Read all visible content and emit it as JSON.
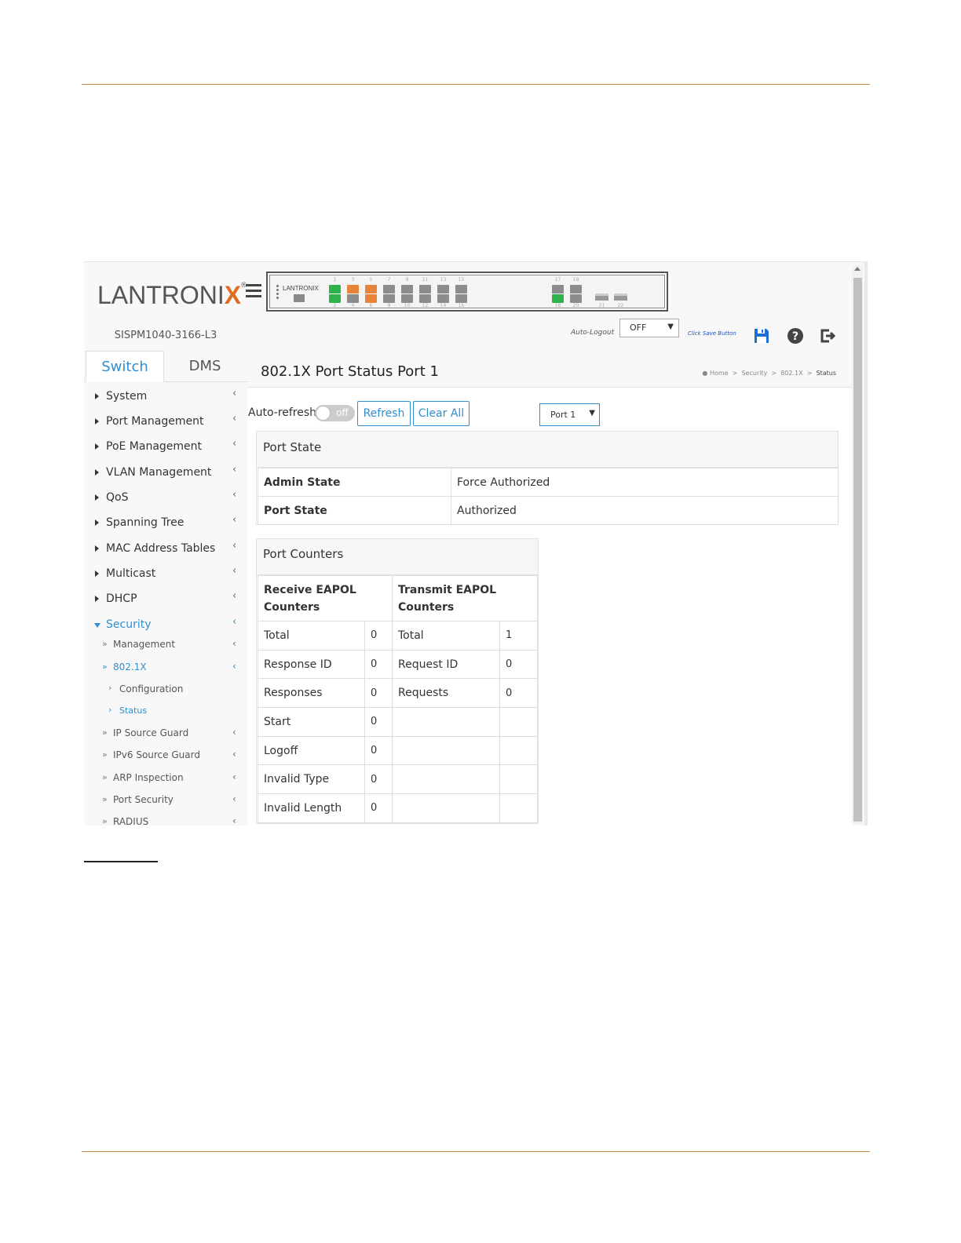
{
  "header": {
    "logo_text": "LANTRONIX",
    "logo_reg": "®",
    "hostname": "SISPM1040-3166-L3",
    "panel_logo": "LANTRONIX",
    "ports_top": [
      "1",
      "3",
      "5",
      "7",
      "9",
      "11",
      "13",
      "15",
      "17",
      "19"
    ],
    "ports_bottom": [
      "2",
      "4",
      "6",
      "8",
      "10",
      "12",
      "14",
      "16",
      "18",
      "20",
      "21",
      "22"
    ],
    "port_colors": [
      "#2db34a",
      "#2db34a",
      "#e8843a",
      "#8c8c8c",
      "#e8843a",
      "#e8843a",
      "#8c8c8c",
      "#8c8c8c",
      "#8c8c8c",
      "#8c8c8c",
      "#8c8c8c",
      "#8c8c8c",
      "#8c8c8c",
      "#8c8c8c",
      "#8c8c8c",
      "#8c8c8c"
    ],
    "auto_logout_label": "Auto-Logout",
    "auto_logout_value": "OFF",
    "save_hint": "Click Save Button",
    "icons": [
      "save-icon",
      "help-icon",
      "logout-icon"
    ]
  },
  "tabs": {
    "switch": "Switch",
    "dms": "DMS"
  },
  "nav": {
    "system": "System",
    "port_management": "Port Management",
    "poe_management": "PoE Management",
    "vlan_management": "VLAN Management",
    "qos": "QoS",
    "spanning_tree": "Spanning Tree",
    "mac_address_tables": "MAC Address Tables",
    "multicast": "Multicast",
    "dhcp": "DHCP",
    "security": "Security",
    "management": "Management",
    "dot1x": "802.1X",
    "configuration": "Configuration",
    "status": "Status",
    "ip_source_guard": "IP Source Guard",
    "ipv6_source_guard": "IPv6 Source Guard",
    "arp_inspection": "ARP Inspection",
    "port_security": "Port Security",
    "radius": "RADIUS"
  },
  "page": {
    "title": "802.1X Port Status Port 1",
    "breadcrumb": {
      "home": "Home",
      "security": "Security",
      "dot1x": "802.1X",
      "status": "Status",
      "sep": ">"
    },
    "auto_refresh_label": "Auto-refresh",
    "auto_refresh_state": "off",
    "refresh_button": "Refresh",
    "clear_all_button": "Clear All",
    "port_select_value": "Port 1"
  },
  "port_state": {
    "heading": "Port State",
    "rows": [
      {
        "label": "Admin State",
        "value": "Force Authorized"
      },
      {
        "label": "Port State",
        "value": "Authorized"
      }
    ]
  },
  "port_counters": {
    "heading": "Port Counters",
    "receive_header": "Receive EAPOL Counters",
    "transmit_header": "Transmit EAPOL Counters",
    "rows": [
      {
        "rx_label": "Total",
        "rx_value": "0",
        "tx_label": "Total",
        "tx_value": "1"
      },
      {
        "rx_label": "Response ID",
        "rx_value": "0",
        "tx_label": "Request ID",
        "tx_value": "0"
      },
      {
        "rx_label": "Responses",
        "rx_value": "0",
        "tx_label": "Requests",
        "tx_value": "0"
      },
      {
        "rx_label": "Start",
        "rx_value": "0",
        "tx_label": "",
        "tx_value": ""
      },
      {
        "rx_label": "Logoff",
        "rx_value": "0",
        "tx_label": "",
        "tx_value": ""
      },
      {
        "rx_label": "Invalid Type",
        "rx_value": "0",
        "tx_label": "",
        "tx_value": ""
      },
      {
        "rx_label": "Invalid Length",
        "rx_value": "0",
        "tx_label": "",
        "tx_value": ""
      }
    ]
  },
  "colors": {
    "accent": "#2f8fd0",
    "rule": "#c8874a",
    "logo_x": "#e06c1f"
  }
}
